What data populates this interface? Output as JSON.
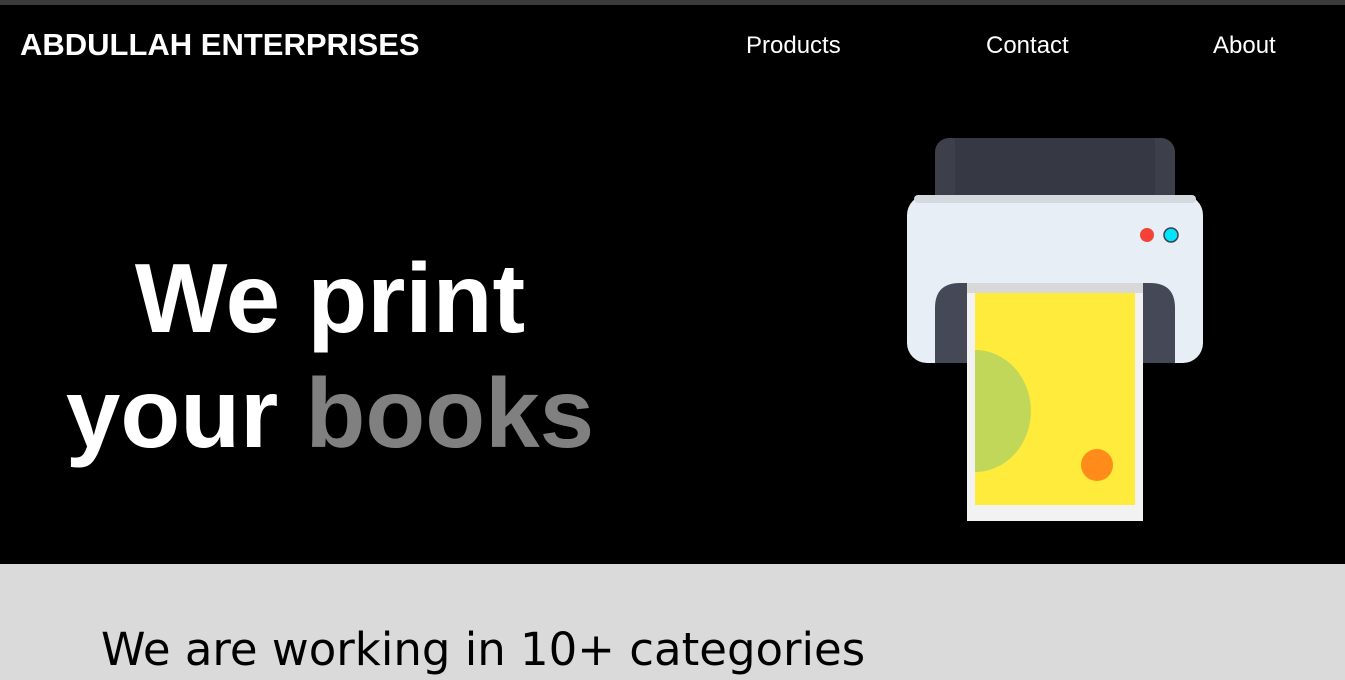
{
  "header": {
    "brand": "ABDULLAH ENTERPRISES",
    "nav": [
      {
        "label": "Products"
      },
      {
        "label": "Contact"
      },
      {
        "label": "About"
      }
    ]
  },
  "hero": {
    "line1": "We print",
    "line2_primary": "your",
    "line2_accent": "books",
    "illustration": "printer-icon"
  },
  "categories": {
    "heading": "We are working in 10+ categories"
  },
  "colors": {
    "hero_background": "#000000",
    "section_background": "#dadada",
    "accent_text": "#808080",
    "paper": "#ffeb3b",
    "printer_body": "#e8eef5",
    "printer_dark": "#3d404b",
    "led_red": "#f44336",
    "led_cyan": "#00e5ff"
  }
}
